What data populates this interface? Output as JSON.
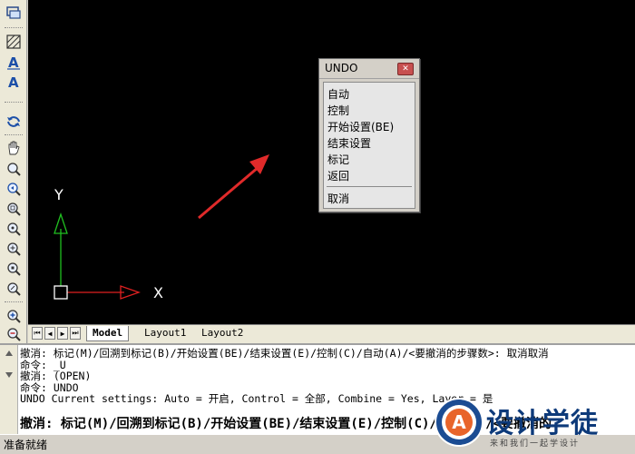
{
  "toolbar": {
    "icons": [
      "windows-icon",
      "hatch-icon",
      "text-icon",
      "multiline-text-icon",
      "undo-redo-icon",
      "pan-icon",
      "zoom-realtime-icon",
      "zoom-previous-icon",
      "zoom-window-icon",
      "zoom-dynamic-icon",
      "zoom-scale-icon",
      "zoom-center-icon",
      "zoom-object-icon",
      "zoom-in-icon",
      "zoom-out-icon"
    ]
  },
  "canvas": {
    "background": "#000000",
    "ucs": {
      "x_label": "X",
      "y_label": "Y",
      "x_color": "#e02020",
      "y_color": "#20c020"
    },
    "arrow_color": "#e02a2a"
  },
  "tabs": {
    "items": [
      "Model",
      "Layout1",
      "Layout2"
    ],
    "active": "Model"
  },
  "undo_popup": {
    "title": "UNDO",
    "items": [
      "自动",
      "控制",
      "开始设置(BE)",
      "结束设置",
      "标记",
      "返回"
    ],
    "cancel": "取消"
  },
  "command": {
    "history": [
      "撤消: 标记(M)/回溯到标记(B)/开始设置(BE)/结束设置(E)/控制(C)/自动(A)/<要撤消的步骤数>: 取消取消",
      "命令: _U",
      "撤消: (OPEN)",
      "命令: UNDO",
      "UNDO Current settings: Auto = 开启, Control = 全部, Combine = Yes, Layer = 是"
    ],
    "current": "撤消: 标记(M)/回溯到标记(B)/开始设置(BE)/结束设置(E)/控制(C)/自动(A)/<要撤消的"
  },
  "status": {
    "text": "准备就绪"
  },
  "watermark": {
    "title": "设计学徒",
    "subtitle": "来和我们一起学设计",
    "logo_letter": "A"
  }
}
